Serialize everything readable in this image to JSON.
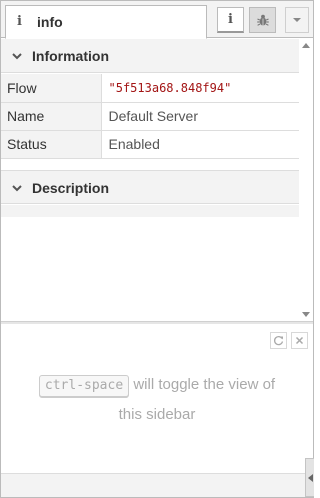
{
  "tabs": {
    "active": {
      "icon": "info-icon",
      "glyph": "i",
      "label": "info"
    },
    "buttons": [
      {
        "name": "info-icon",
        "glyph": "i"
      },
      {
        "name": "bug-icon"
      },
      {
        "name": "chevron-down-icon"
      }
    ]
  },
  "info_section": {
    "title": "Information",
    "rows": [
      {
        "key": "Flow",
        "value": "\"5f513a68.848f94\""
      },
      {
        "key": "Name",
        "value": "Default Server"
      },
      {
        "key": "Status",
        "value": "Enabled"
      }
    ]
  },
  "description_section": {
    "title": "Description"
  },
  "help": {
    "shortcut": "ctrl-space",
    "message_line1": "will toggle the view of",
    "message_line2": "this sidebar",
    "buttons": [
      "refresh-icon",
      "close-icon"
    ]
  },
  "colors": {
    "header_bg": "#f3f3f3",
    "border": "#bbbbbb",
    "string_value": "#a31515",
    "hint_text": "#aaaaaa"
  }
}
